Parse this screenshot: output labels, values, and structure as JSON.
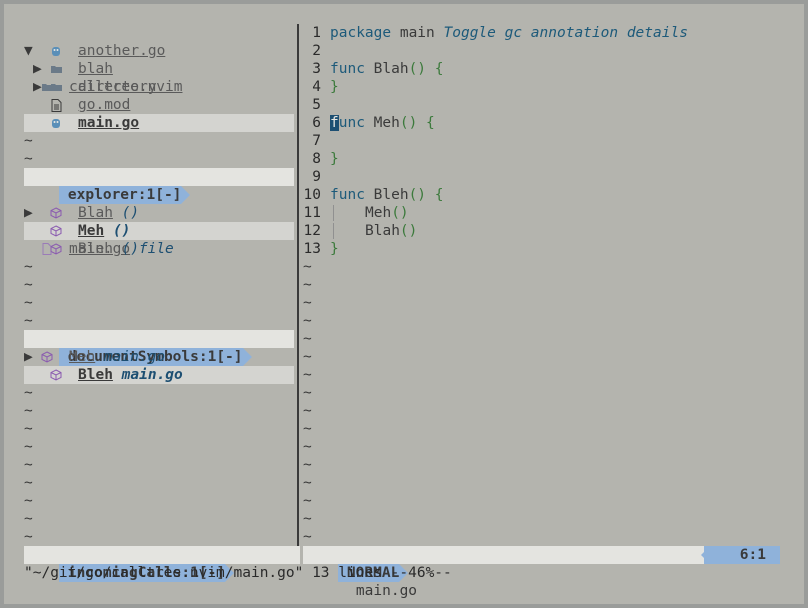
{
  "explorer": {
    "root": {
      "fold": "▼",
      "name": "calltree",
      "ext": ".nvim"
    },
    "items": [
      {
        "fold": "",
        "name": "another",
        "ext": ".go",
        "icon": "go-file-icon",
        "selected": false
      },
      {
        "fold": "▶",
        "name": "blah",
        "ext": "",
        "icon": "folder-icon",
        "selected": false
      },
      {
        "fold": "▶",
        "name": "directory",
        "ext": "",
        "icon": "folder-icon",
        "selected": false
      },
      {
        "fold": "",
        "name": "go",
        "ext": ".mod",
        "icon": "text-file-icon",
        "selected": false
      },
      {
        "fold": "",
        "name": "main",
        "ext": ".go",
        "icon": "go-file-icon",
        "selected": true
      }
    ],
    "status": "explorer:1[-]"
  },
  "symbols_panel": {
    "header": {
      "fold": "▶",
      "name": "main",
      "ext": ".go",
      "kind": "file"
    },
    "items": [
      {
        "name": "Blah",
        "sig": "()",
        "selected": false
      },
      {
        "name": "Meh",
        "sig": "()",
        "selected": true
      },
      {
        "name": "Bleh",
        "sig": "()",
        "selected": false
      }
    ]
  },
  "document_symbols": {
    "status": "documentSymbols:1[-]",
    "items": [
      {
        "fold": "▶",
        "name": "Meh",
        "file": "main.go",
        "selected": false
      },
      {
        "fold": "",
        "name": "Bleh",
        "file": "main.go",
        "selected": true
      }
    ]
  },
  "incoming_calls": {
    "status": "incomingCalls:1[-]"
  },
  "editor": {
    "annotation": "Toggle gc annotation details",
    "lines": [
      {
        "n": "1",
        "kw": "package",
        "rest": " main"
      },
      {
        "n": "2",
        "kw": "",
        "rest": ""
      },
      {
        "n": "3",
        "kw": "func",
        "rest": " Blah",
        "p": "() {"
      },
      {
        "n": "4",
        "kw": "",
        "rest": "",
        "close": "}"
      },
      {
        "n": "5",
        "kw": "",
        "rest": ""
      },
      {
        "n": "6",
        "kw": "func",
        "rest": " Meh",
        "p": "() {"
      },
      {
        "n": "7",
        "kw": "",
        "rest": ""
      },
      {
        "n": "8",
        "kw": "",
        "rest": "",
        "close": "}"
      },
      {
        "n": "9",
        "kw": "",
        "rest": ""
      },
      {
        "n": "10",
        "kw": "func",
        "rest": " Bleh",
        "p": "() {"
      },
      {
        "n": "11",
        "call": "Meh",
        "p": "()"
      },
      {
        "n": "12",
        "call": "Blah",
        "p": "()"
      },
      {
        "n": "13",
        "kw": "",
        "rest": "",
        "close": "}"
      }
    ],
    "mode": "NORMAL",
    "filename": "main.go",
    "position": "6:1"
  },
  "message": "\"~/git/go/calltree.nvim/main.go\" 13 lines --46%--",
  "colors": {
    "accent": "#8fb2da",
    "background": "#b4b4ae",
    "keyword": "#1d5a7a",
    "paren": "#3c7a3c"
  }
}
